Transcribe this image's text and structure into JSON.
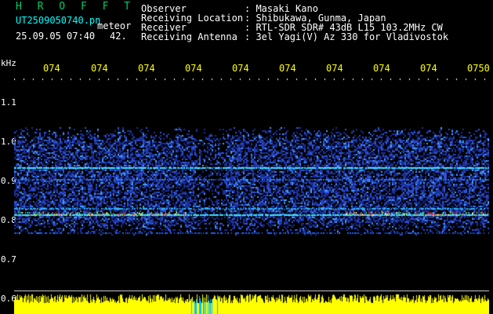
{
  "app": {
    "title": "H R O F F T",
    "file_name": "UT2509050740.pn",
    "meteor_label": "meteor",
    "datetime": "25.09.05 07:40",
    "count": "42."
  },
  "info": {
    "rows": [
      {
        "label": "Observer",
        "value": ": Masaki Kano"
      },
      {
        "label": "Receiving Location",
        "value": ": Shibukawa, Gunma, Japan"
      },
      {
        "label": "Receiver",
        "value": ": RTL-SDR SDR# 43dB L15 103.2MHz CW"
      },
      {
        "label": "Receiving Antenna",
        "value": ": 3el Yagi(V) Az 330 for Vladivostok"
      }
    ]
  },
  "axis": {
    "unit": "kHz",
    "time_ticks": [
      "074",
      "074",
      "074",
      "074",
      "074",
      "074",
      "074",
      "074",
      "074",
      "0750"
    ],
    "freq_ticks": [
      "1.1",
      "1.0",
      "0.9",
      "0.8",
      "0.7",
      "0.6"
    ]
  },
  "colors": {
    "title": "#00cc66",
    "text": "#ffffff",
    "filename": "#00ffff",
    "tick_time": "#ffff00",
    "tick_freq": "#ffffff",
    "spectrum_bg": "#0a1a4a",
    "spectrum_noise": "#2040c0",
    "line_cyan": "#40e0ff",
    "line_red": "#ff3030",
    "bars": "#ffff00",
    "bars_cyan": "#00c0ff"
  }
}
